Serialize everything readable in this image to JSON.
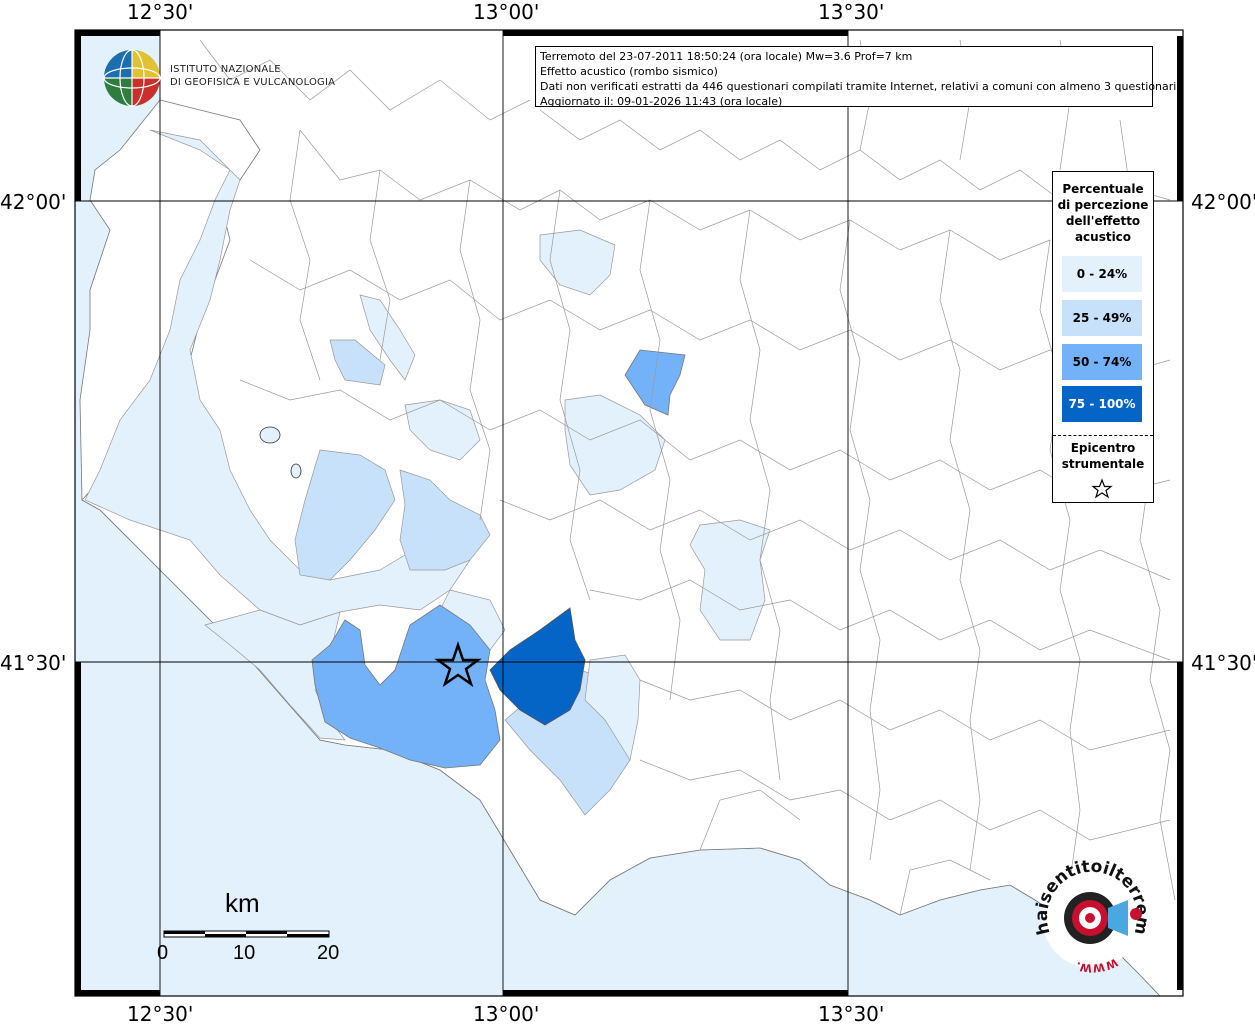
{
  "info": {
    "line1": "Terremoto del 23-07-2011 18:50:24 (ora locale) Mw=3.6 Prof=7 km",
    "line2": "Effetto acustico (rombo sismico)",
    "line3": "Dati non verificati estratti da 446 questionari compilati tramite Internet, relativi a comuni con almeno 3 questionari.",
    "line4": "Aggiornato il: 09-01-2026 11:43 (ora locale)"
  },
  "axes": {
    "top": [
      "12°30'",
      "13°00'",
      "13°30'"
    ],
    "bottom": [
      "12°30'",
      "13°00'",
      "13°30'"
    ],
    "left": [
      "42°00'",
      "41°30'"
    ],
    "right": [
      "42°00'",
      "41°30'"
    ]
  },
  "legend": {
    "title_lines": [
      "Percentuale",
      "di percezione",
      "dell'effetto",
      "acustico"
    ],
    "classes": [
      {
        "label": "0 - 24%",
        "color": "#e3f1fc"
      },
      {
        "label": "25 - 49%",
        "color": "#c8e1fa"
      },
      {
        "label": "50 - 74%",
        "color": "#73b2f9"
      },
      {
        "label": "75 - 100%",
        "color": "#0565c7"
      }
    ],
    "epicenter_lines": [
      "Epicentro",
      "strumentale"
    ]
  },
  "scale": {
    "unit": "km",
    "labels": [
      "0",
      "10",
      "20"
    ]
  },
  "logos": {
    "ingv_line1": "ISTITUTO NAZIONALE",
    "ingv_line2": "DI GEOFISICA E VULCANOLOGIA",
    "hsl_text": "haisentitoilterremoto.it",
    "hsl_url_text": "WWW."
  },
  "colors": {
    "sea": "#e3f1fc",
    "land": "#ffffff",
    "boundary": "#9a9a9a",
    "grid": "#000000"
  }
}
